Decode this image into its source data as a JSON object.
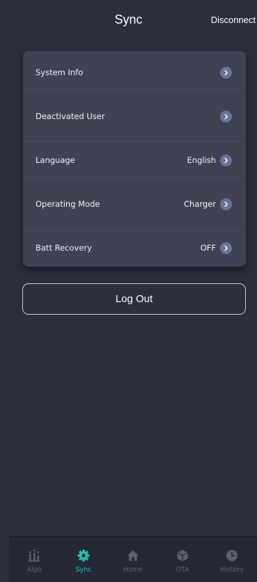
{
  "header": {
    "title": "Sync",
    "action": "Disconnect"
  },
  "settings": {
    "items": [
      {
        "label": "System Info",
        "value": ""
      },
      {
        "label": "Deactivated User",
        "value": ""
      },
      {
        "label": "Language",
        "value": "English"
      },
      {
        "label": "Operating Mode",
        "value": "Charger"
      },
      {
        "label": "Batt Recovery",
        "value": "OFF"
      }
    ]
  },
  "logout_label": "Log Out",
  "tabs": [
    {
      "label": "Algo",
      "icon": "algo-icon",
      "active": false
    },
    {
      "label": "Sync",
      "icon": "gear-icon",
      "active": true
    },
    {
      "label": "Home",
      "icon": "home-icon",
      "active": false
    },
    {
      "label": "OTA",
      "icon": "package-icon",
      "active": false
    },
    {
      "label": "History",
      "icon": "clock-icon",
      "active": false
    }
  ],
  "colors": {
    "background": "#2b2e3b",
    "card": "#3f4253",
    "accent": "#22c3b0",
    "inactive": "#5c6072",
    "chevron": "#6b7396"
  }
}
